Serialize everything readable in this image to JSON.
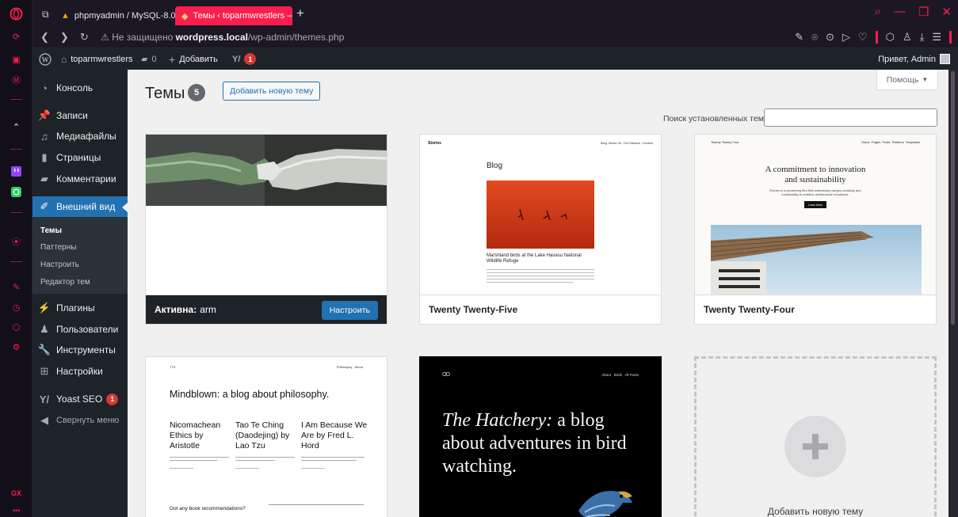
{
  "browser": {
    "tabs": [
      {
        "label": "phpmyadmin / MySQL-8.0"
      },
      {
        "label": "Темы ‹ toparmwrestlers —"
      }
    ],
    "new_tab_label": "+",
    "address": {
      "warning": "Не защищено",
      "host": "wordpress.local",
      "path": "/wp-admin/themes.php"
    },
    "accent": "#fa1e4e"
  },
  "adminbar": {
    "site_name": "toparmwrestlers",
    "comments_count": "0",
    "add_new_label": "Добавить",
    "yoast_badge": "1",
    "greeting": "Привет, Admin"
  },
  "sidebar": {
    "items": [
      {
        "label": "Консоль",
        "icon": "dashboard-icon"
      },
      {
        "label": "Записи",
        "icon": "pin-icon"
      },
      {
        "label": "Медиафайлы",
        "icon": "media-icon"
      },
      {
        "label": "Страницы",
        "icon": "page-icon"
      },
      {
        "label": "Комментарии",
        "icon": "comment-icon"
      },
      {
        "label": "Внешний вид",
        "icon": "brush-icon"
      },
      {
        "label": "Плагины",
        "icon": "plugin-icon"
      },
      {
        "label": "Пользователи",
        "icon": "users-icon"
      },
      {
        "label": "Инструменты",
        "icon": "wrench-icon"
      },
      {
        "label": "Настройки",
        "icon": "settings-icon"
      },
      {
        "label": "Yoast SEO",
        "icon": "yoast-icon",
        "badge": "1"
      },
      {
        "label": "Свернуть меню",
        "icon": "collapse-icon"
      }
    ],
    "submenu": [
      "Темы",
      "Паттерны",
      "Настроить",
      "Редактор тем"
    ]
  },
  "page": {
    "title": "Темы",
    "count": "5",
    "add_new_button": "Добавить новую тему",
    "help_button": "Помощь",
    "search_label": "Поиск установленных тем"
  },
  "themes": {
    "active": {
      "active_prefix": "Активна:",
      "name": "arm",
      "customize_button": "Настроить"
    },
    "t25": {
      "name": "Twenty Twenty-Five",
      "preview": {
        "site": "Stories",
        "nav": "Blog  About Us  Our Mission  Contact",
        "heading": "Blog",
        "caption": "Marshland birds at the Lake Havasu National Wildlife Refuge"
      }
    },
    "t24": {
      "name": "Twenty Twenty-Four",
      "preview": {
        "site": "Twenty Twenty Four",
        "nav": "Home  Pages  Posts  Patterns  Templates",
        "heading": "A commitment to innovation and sustainability",
        "sub": "Études is a pioneering firm that seamlessly merges creativity and functionality to redefine architectural excellence.",
        "button": "Learn More"
      }
    },
    "t23": {
      "preview": {
        "site": "TT5",
        "nav": "Philosophy   About",
        "heading": "Mindblown: a blog about philosophy.",
        "posts": [
          "Nicomachean Ethics by Aristotle",
          "Tao Te Ching (Daodejing) by Lao Tzu",
          "I Am Because We Are by Fred L. Hord"
        ],
        "question": "Got any book recommendations?"
      }
    },
    "t22": {
      "preview": {
        "logo": "OO",
        "nav": "About   Birds   All Posts",
        "heading_italic": "The Hatchery:",
        "heading_rest": " a blog about adventures in bird watching."
      }
    },
    "add_new_card": "Добавить новую тему"
  }
}
